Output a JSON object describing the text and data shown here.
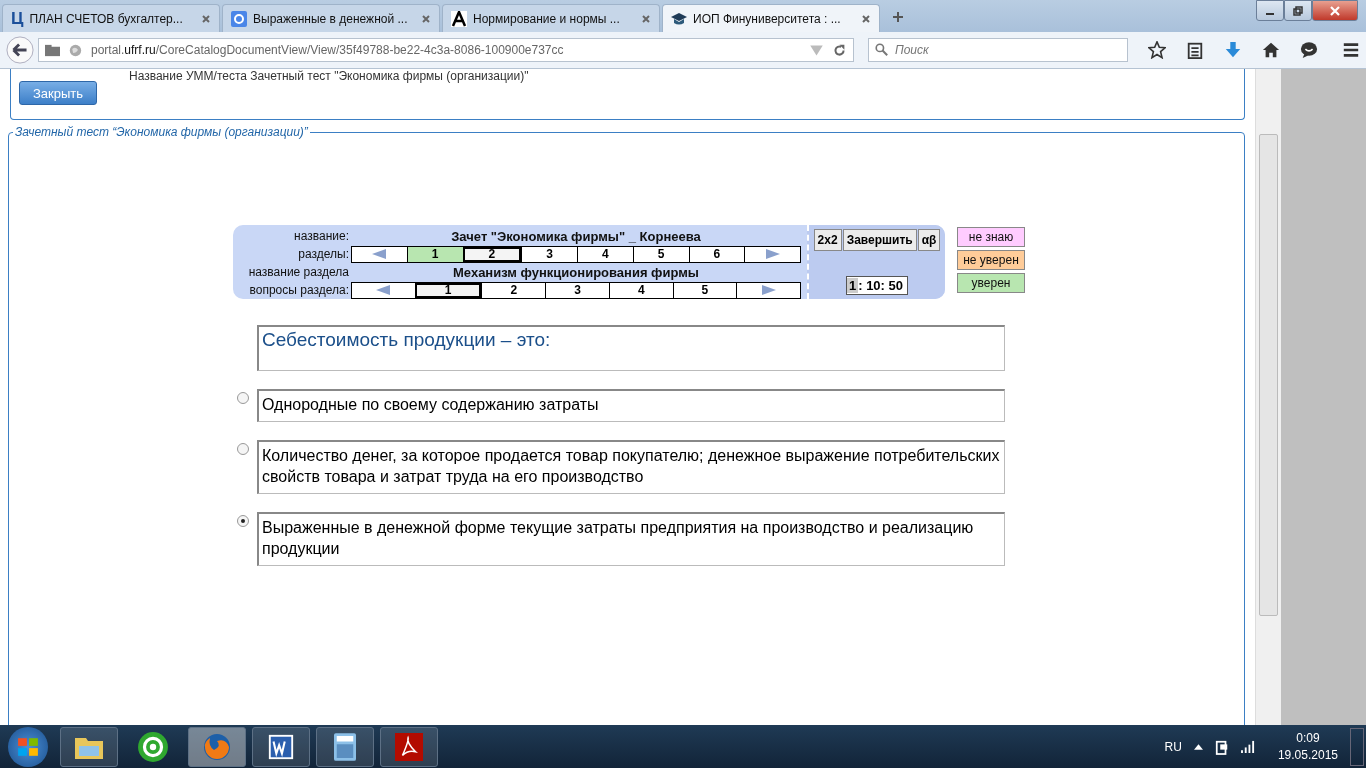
{
  "browser": {
    "tabs": [
      {
        "title": "ПЛАН СЧЕТОВ бухгалтер...",
        "selected": false
      },
      {
        "title": "Выраженные в денежной ...",
        "selected": false
      },
      {
        "title": "Нормирование и нормы ...",
        "selected": false
      },
      {
        "title": "ИОП Финуниверситета : ...",
        "selected": true
      }
    ],
    "url_host_pre": "portal.",
    "url_host": "ufrf.ru",
    "url_path": "/CoreCatalogDocumentView/View/35f49788-be22-4c3a-8086-100900e737cc",
    "tab_letter": "Ц",
    "search": {
      "placeholder": "Поиск"
    }
  },
  "page": {
    "header_text": "Название УММ/теста  Зачетный тест  \"Экономика фирмы (организации)\"",
    "close_button": "Закрыть",
    "legend": "Зачетный тест “Экономика фирмы (организации)”"
  },
  "test": {
    "title_label": "название:",
    "title": "Зачет \"Экономика фирмы\" _ Корнеева",
    "sections_label": "разделы:",
    "sections": [
      {
        "label": "1",
        "answered": true,
        "selected": false
      },
      {
        "label": "2",
        "answered": false,
        "selected": true
      },
      {
        "label": "3",
        "answered": false,
        "selected": false
      },
      {
        "label": "4",
        "answered": false,
        "selected": false
      },
      {
        "label": "5",
        "answered": false,
        "selected": false
      },
      {
        "label": "6",
        "answered": false,
        "selected": false
      }
    ],
    "section_name_label": "название раздела",
    "section_name": "Механизм функционирования  фирмы",
    "questions_label": "вопросы раздела:",
    "questions": [
      {
        "label": "1",
        "selected": true
      },
      {
        "label": "2",
        "selected": false
      },
      {
        "label": "3",
        "selected": false
      },
      {
        "label": "4",
        "selected": false
      },
      {
        "label": "5",
        "selected": false
      }
    ],
    "buttons": [
      "2x2",
      "Завершить",
      "αβ"
    ],
    "timer_hours": "1",
    "timer_rest": ": 10: 50",
    "confidence": [
      {
        "label": "не знаю",
        "color": "#ffccff"
      },
      {
        "label": "не уверен",
        "color": "#ffcc99"
      },
      {
        "label": "уверен",
        "color": "#b8e6b0"
      }
    ],
    "question": "Себестоимость продукции – это:",
    "answers": [
      {
        "text": "Однородные по своему содержанию затраты",
        "selected": false
      },
      {
        "text": "Количество денег, за которое продается товар покупателю; денежное выражение потребительских свойств товара и затрат труда на его производство",
        "selected": false
      },
      {
        "text": "Выраженные в денежной форме текущие затраты предприятия на производство и реализацию продукции",
        "selected": true
      }
    ]
  },
  "taskbar": {
    "apps": [
      {
        "kind": "folder",
        "active": false
      },
      {
        "kind": "mail",
        "active": false
      },
      {
        "kind": "firefox",
        "active": true
      },
      {
        "kind": "word",
        "active": false
      },
      {
        "kind": "calc",
        "active": false
      },
      {
        "kind": "pdf",
        "active": false
      }
    ],
    "language": "RU",
    "time": "0:09",
    "date": "19.05.2015"
  }
}
